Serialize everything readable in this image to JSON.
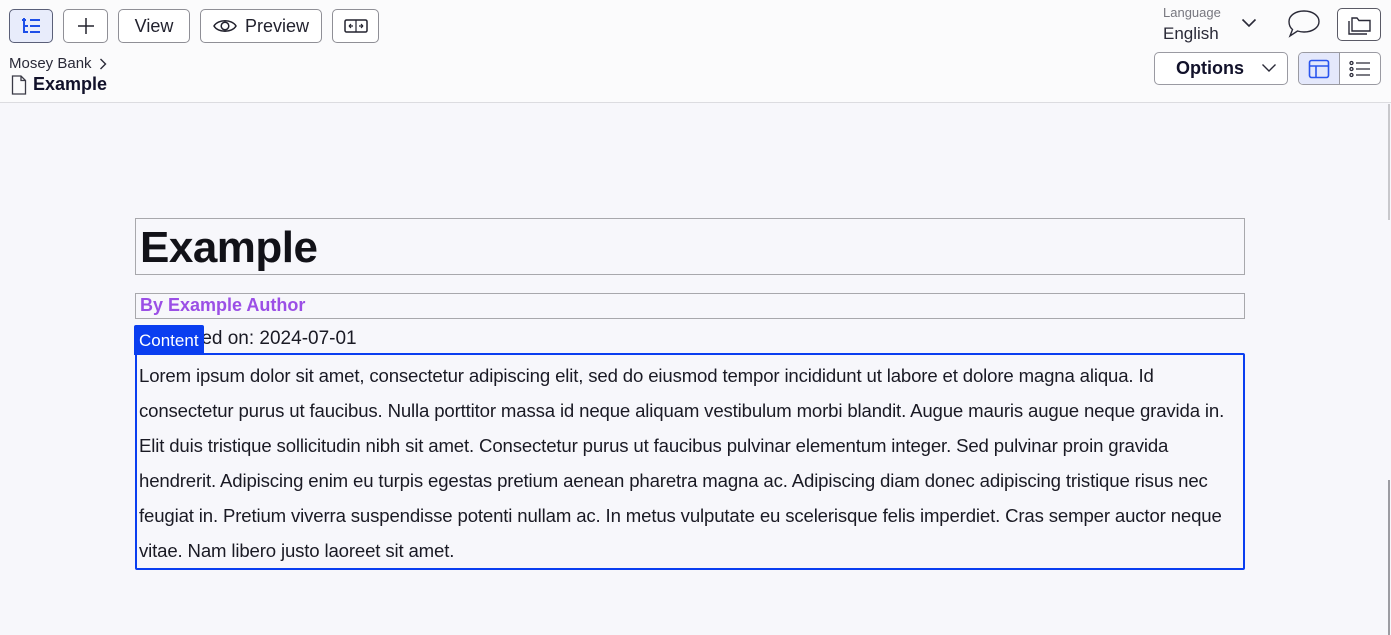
{
  "toolbar": {
    "view_label": "View",
    "preview_label": "Preview",
    "icons": {
      "tree": "tree-structure-icon",
      "add": "plus-icon",
      "preview": "eye-icon",
      "split": "split-view-icon"
    }
  },
  "breadcrumb": {
    "parent": "Mosey Bank",
    "current": "Example"
  },
  "language": {
    "caption": "Language",
    "value": "English"
  },
  "options": {
    "label": "Options"
  },
  "view_toggle": {
    "active": "layout"
  },
  "document": {
    "title": "Example",
    "author": "By Example Author",
    "date_line": "Published on: 2024-07-01",
    "content_tag": "Content",
    "body": "Lorem ipsum dolor sit amet, consectetur adipiscing elit, sed do eiusmod tempor incididunt ut labore et dolore magna aliqua. Id consectetur purus ut faucibus. Nulla porttitor massa id neque aliquam vestibulum morbi blandit. Augue mauris augue neque gravida in. Elit duis tristique sollicitudin nibh sit amet. Consectetur purus ut faucibus pulvinar elementum integer. Sed pulvinar proin gravida hendrerit. Adipiscing enim eu turpis egestas pretium aenean pharetra magna ac. Adipiscing diam donec adipiscing tristique risus nec feugiat in. Pretium viverra suspendisse potenti nullam ac. In metus vulputate eu scelerisque felis imperdiet. Cras semper auctor neque vitae. Nam libero justo laoreet sit amet."
  },
  "colors": {
    "accent": "#0a3ef0",
    "author": "#9b4fe6",
    "canvas": "#f7f7fb",
    "header": "#fbfbfc"
  }
}
